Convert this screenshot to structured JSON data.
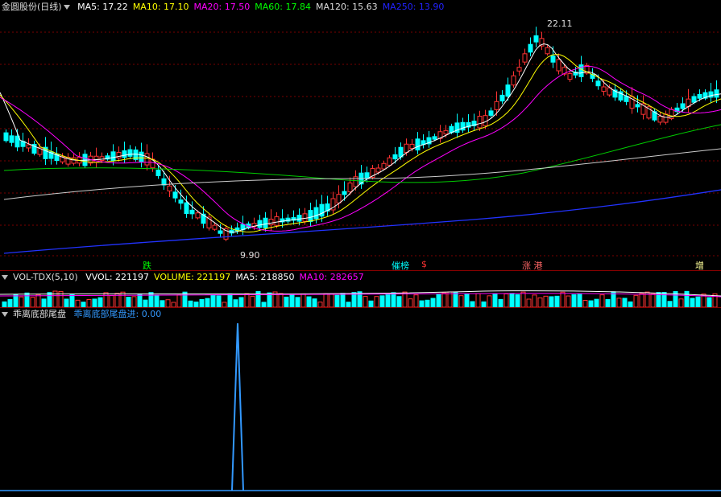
{
  "main": {
    "title": "金圆股份(日线)",
    "ma_items": [
      {
        "label": "MA5: 17.22",
        "color": "#ffffff"
      },
      {
        "label": "MA10: 17.10",
        "color": "#ffff00"
      },
      {
        "label": "MA20: 17.50",
        "color": "#ff00ff"
      },
      {
        "label": "MA60: 17.84",
        "color": "#00ff00"
      },
      {
        "label": "MA120: 15.63",
        "color": "#dddddd"
      },
      {
        "label": "MA250: 13.90",
        "color": "#2222ff"
      }
    ],
    "high_label": "22.11",
    "low_label": "9.90",
    "markers": [
      {
        "text": "跌",
        "color": "#00ff00"
      },
      {
        "text": "催榜",
        "color": "#00ffff"
      },
      {
        "text": "$",
        "color": "#ff3333"
      },
      {
        "text": "涨 港",
        "color": "#ff6666"
      },
      {
        "text": "增",
        "color": "#ffff99"
      }
    ]
  },
  "volume": {
    "indicator": "VOL-TDX(5,10)",
    "items": [
      {
        "label": "VVOL: 221197",
        "color": "#ffffff"
      },
      {
        "label": "VOLUME: 221197",
        "color": "#ffff00"
      },
      {
        "label": "MA5: 218850",
        "color": "#ffffff"
      },
      {
        "label": "MA10: 282657",
        "color": "#ff00ff"
      }
    ]
  },
  "indicator": {
    "title": "乖离底部尾盘",
    "value_label": "乖离底部尾盘进: 0.00",
    "value_color": "#3399ff"
  },
  "colors": {
    "up": "#ff3333",
    "down": "#00ffff",
    "grid": "#7a0000"
  }
}
